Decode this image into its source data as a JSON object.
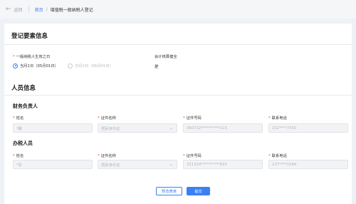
{
  "header": {
    "back_label": "返回",
    "breadcrumb_home": "首页",
    "breadcrumb_separator": "/",
    "breadcrumb_current": "增值税一般纳税人登记"
  },
  "registration": {
    "title": "登记要素信息",
    "effective_date_label": "一般纳税人生效之日",
    "options": [
      {
        "label": "当月1日（05月01日）",
        "selected": true
      },
      {
        "label": "次月1日（06月01日）",
        "selected": false
      }
    ],
    "accounting_label": "会计核算健全",
    "accounting_value": "是"
  },
  "personnel": {
    "title": "人员信息",
    "columns": [
      "姓名",
      "证件名称",
      "证件号码",
      "联系电话"
    ],
    "finance": {
      "title": "财务负责人",
      "name": "*鹏",
      "id_type": "居民身份证",
      "id_number": "360732**********115",
      "phone": "152****7350"
    },
    "tax_agent": {
      "title": "办税人员",
      "name": "*军",
      "id_type": "居民身份证",
      "id_number": "321324**********835",
      "phone": "137****1584"
    }
  },
  "actions": {
    "preview_label": "预览表单",
    "submit_label": "提交"
  },
  "colors": {
    "accent": "#3a7ff5",
    "required": "#e53935"
  }
}
